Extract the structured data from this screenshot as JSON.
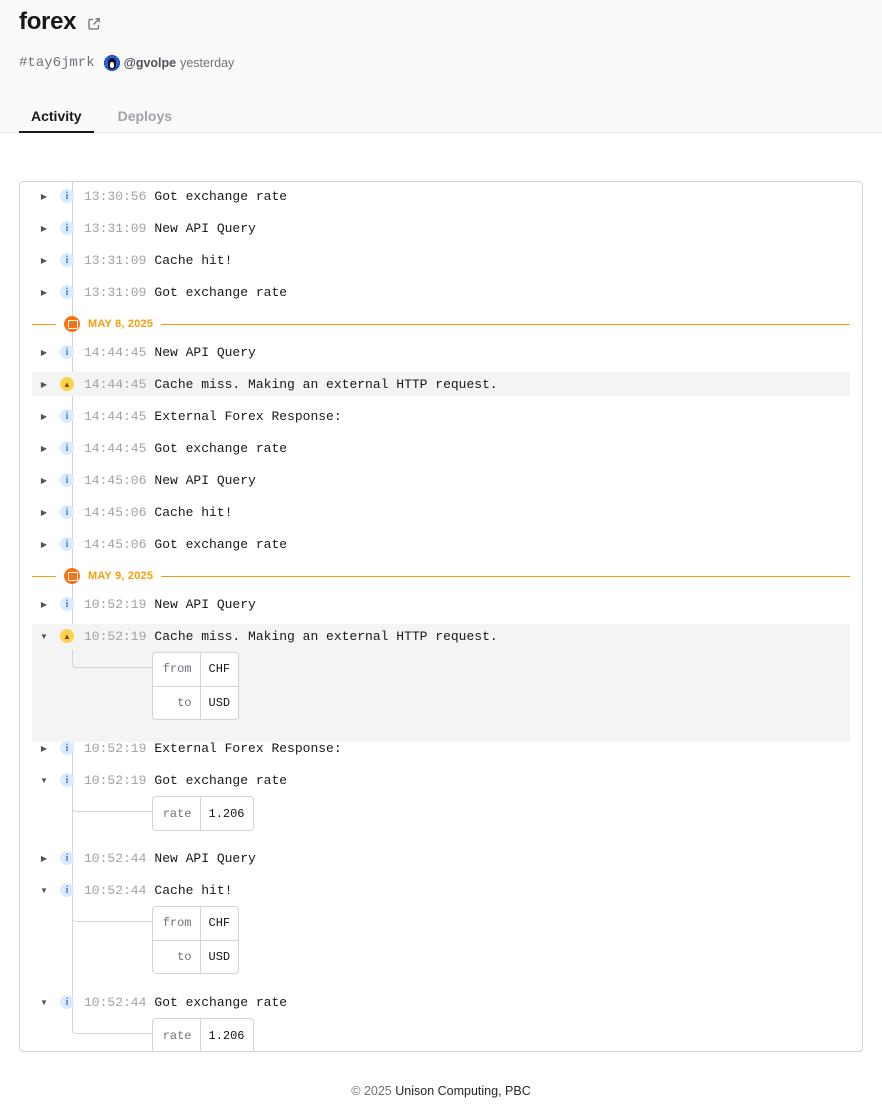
{
  "project": {
    "title": "forex",
    "hash": "#tay6jmrk",
    "user": "@gvolpe",
    "when": "yesterday"
  },
  "tabs": [
    "Activity",
    "Deploys"
  ],
  "log": [
    {
      "kind": "entry",
      "level": "info",
      "open": false,
      "time": "13:30:56",
      "msg": "Got exchange rate"
    },
    {
      "kind": "entry",
      "level": "info",
      "open": false,
      "time": "13:31:09",
      "msg": "New API Query"
    },
    {
      "kind": "entry",
      "level": "info",
      "open": false,
      "time": "13:31:09",
      "msg": "Cache hit!"
    },
    {
      "kind": "entry",
      "level": "info",
      "open": false,
      "time": "13:31:09",
      "msg": "Got exchange rate"
    },
    {
      "kind": "date",
      "label": "MAY 8, 2025"
    },
    {
      "kind": "entry",
      "level": "info",
      "open": false,
      "time": "14:44:45",
      "msg": "New API Query"
    },
    {
      "kind": "entry",
      "level": "warn",
      "open": false,
      "time": "14:44:45",
      "msg": "Cache miss. Making an external HTTP request."
    },
    {
      "kind": "entry",
      "level": "info",
      "open": false,
      "time": "14:44:45",
      "msg": "External Forex Response:"
    },
    {
      "kind": "entry",
      "level": "info",
      "open": false,
      "time": "14:44:45",
      "msg": "Got exchange rate"
    },
    {
      "kind": "entry",
      "level": "info",
      "open": false,
      "time": "14:45:06",
      "msg": "New API Query"
    },
    {
      "kind": "entry",
      "level": "info",
      "open": false,
      "time": "14:45:06",
      "msg": "Cache hit!"
    },
    {
      "kind": "entry",
      "level": "info",
      "open": false,
      "time": "14:45:06",
      "msg": "Got exchange rate"
    },
    {
      "kind": "date",
      "label": "MAY 9, 2025"
    },
    {
      "kind": "entry",
      "level": "info",
      "open": false,
      "time": "10:52:19",
      "msg": "New API Query"
    },
    {
      "kind": "entry",
      "level": "warn",
      "open": true,
      "time": "10:52:19",
      "msg": "Cache miss. Making an external HTTP request.",
      "fields": [
        [
          "from",
          "CHF"
        ],
        [
          "to",
          "USD"
        ]
      ]
    },
    {
      "kind": "entry",
      "level": "info",
      "open": false,
      "time": "10:52:19",
      "msg": "External Forex Response:"
    },
    {
      "kind": "entry",
      "level": "info",
      "open": true,
      "time": "10:52:19",
      "msg": "Got exchange rate",
      "fields": [
        [
          "rate",
          "1.206"
        ]
      ]
    },
    {
      "kind": "entry",
      "level": "info",
      "open": false,
      "time": "10:52:44",
      "msg": "New API Query"
    },
    {
      "kind": "entry",
      "level": "info",
      "open": true,
      "time": "10:52:44",
      "msg": "Cache hit!",
      "fields": [
        [
          "from",
          "CHF"
        ],
        [
          "to",
          "USD"
        ]
      ]
    },
    {
      "kind": "entry",
      "level": "info",
      "open": true,
      "time": "10:52:44",
      "msg": "Got exchange rate",
      "fields": [
        [
          "rate",
          "1.206"
        ]
      ]
    }
  ],
  "footer": {
    "copyright": "© 2025",
    "company": "Unison Computing, PBC"
  },
  "colors": {
    "accent_date": "#f59e0b",
    "info": "#3b82f6",
    "warn": "#fcd34d"
  }
}
